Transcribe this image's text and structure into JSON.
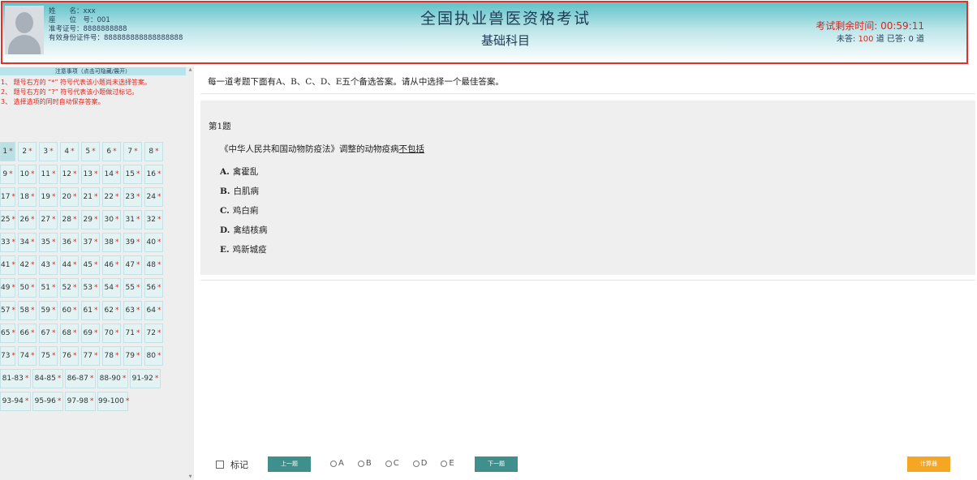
{
  "header": {
    "candidate": {
      "name_label": "姓　　名：",
      "name": "xxx",
      "seat_label": "座　　位　号：",
      "seat": "001",
      "ticket_label": "准考证号：",
      "ticket": "8888888888",
      "id_label": "有效身份证件号：",
      "id": "888888888888888888"
    },
    "title": "全国执业兽医资格考试",
    "subject": "基础科目",
    "timer_label": "考试剩余时间: ",
    "timer_value": "00:59:11",
    "unanswered_label": "未答: ",
    "unanswered_count": "100",
    "answered_label": " 道 已答: ",
    "answered_count": "0",
    "unit": " 道"
  },
  "sidebar": {
    "notice_title": "注意事项（点击可隐藏/展开）",
    "notices": [
      "1、 题号右方的 “*” 符号代表该小题尚未选择答案。",
      "2、 题号右方的 “?” 符号代表该小题做过标记。",
      "3、 选择选项的同时自动保存答案。"
    ],
    "star": "*",
    "rows": [
      [
        "1",
        "2",
        "3",
        "4",
        "5",
        "6",
        "7",
        "8"
      ],
      [
        "9",
        "10",
        "11",
        "12",
        "13",
        "14",
        "15",
        "16"
      ],
      [
        "17",
        "18",
        "19",
        "20",
        "21",
        "22",
        "23",
        "24"
      ],
      [
        "25",
        "26",
        "27",
        "28",
        "29",
        "30",
        "31",
        "32"
      ],
      [
        "33",
        "34",
        "35",
        "36",
        "37",
        "38",
        "39",
        "40"
      ],
      [
        "41",
        "42",
        "43",
        "44",
        "45",
        "46",
        "47",
        "48"
      ],
      [
        "49",
        "50",
        "51",
        "52",
        "53",
        "54",
        "55",
        "56"
      ],
      [
        "57",
        "58",
        "59",
        "60",
        "61",
        "62",
        "63",
        "64"
      ],
      [
        "65",
        "66",
        "67",
        "68",
        "69",
        "70",
        "71",
        "72"
      ],
      [
        "73",
        "74",
        "75",
        "76",
        "77",
        "78",
        "79",
        "80"
      ],
      [
        "81-83",
        "84-85",
        "86-87",
        "88-90",
        "91-92"
      ],
      [
        "93-94",
        "95-96",
        "97-98",
        "99-100"
      ]
    ],
    "active": "1"
  },
  "main": {
    "instruction": "每一道考题下面有A、B、C、D、E五个备选答案。请从中选择一个最佳答案。",
    "question_number": "第1题",
    "stem_prefix": "《中华人民共和国动物防疫法》调整的动物疫病",
    "stem_underlined": "不包括",
    "options": [
      {
        "key": "A.",
        "text": "禽霍乱"
      },
      {
        "key": "B.",
        "text": "白肌病"
      },
      {
        "key": "C.",
        "text": "鸡白痢"
      },
      {
        "key": "D.",
        "text": "禽结核病"
      },
      {
        "key": "E.",
        "text": "鸡新城疫"
      }
    ]
  },
  "bottom": {
    "mark_label": "标记",
    "prev_label": "上一题",
    "next_label": "下一题",
    "choices": [
      "A",
      "B",
      "C",
      "D",
      "E"
    ],
    "calc_label": "计算器"
  }
}
